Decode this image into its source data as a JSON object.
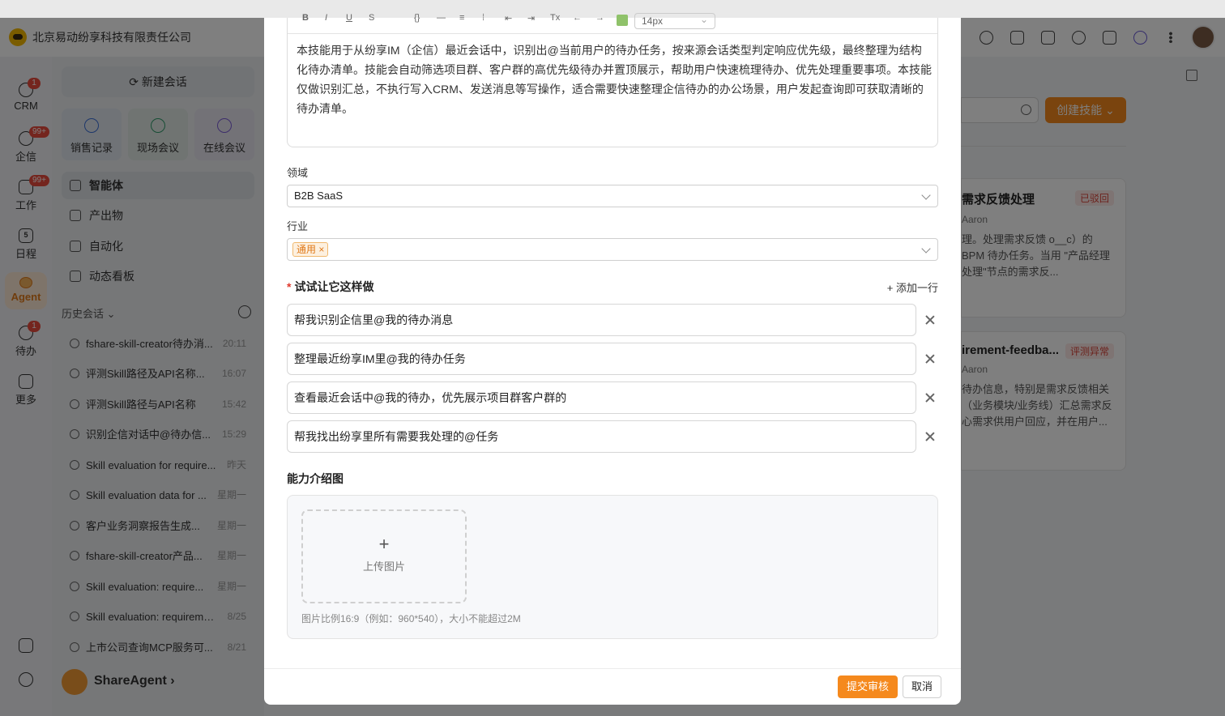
{
  "app": {
    "company": "北京易动纷享科技有限责任公司"
  },
  "leftnav": [
    {
      "label": "CRM",
      "badge": "1",
      "icon": "crm-icon"
    },
    {
      "label": "企信",
      "badge": "99+",
      "icon": "chat-icon"
    },
    {
      "label": "工作",
      "badge": "99+",
      "icon": "work-icon"
    },
    {
      "label": "日程",
      "badge": "",
      "icon": "calendar-icon",
      "glyph": "5"
    },
    {
      "label": "Agent",
      "badge": "",
      "icon": "agent-icon"
    },
    {
      "label": "待办",
      "badge": "1",
      "icon": "todo-icon"
    },
    {
      "label": "更多",
      "badge": "",
      "icon": "grid-icon"
    }
  ],
  "sidebar": {
    "new_chat": "新建会话",
    "quick": [
      "销售记录",
      "现场会议",
      "在线会议"
    ],
    "menu": [
      "智能体",
      "产出物",
      "自动化",
      "动态看板"
    ],
    "history_title": "历史会话",
    "history": [
      {
        "title": "fshare-skill-creator待办消...",
        "time": "20:11"
      },
      {
        "title": "评测Skill路径及API名称...",
        "time": "16:07"
      },
      {
        "title": "评测Skill路径与API名称",
        "time": "15:42"
      },
      {
        "title": "识别企信对话中@待办信...",
        "time": "15:29"
      },
      {
        "title": "Skill evaluation for require...",
        "time": "昨天"
      },
      {
        "title": "Skill evaluation data for ...",
        "time": "星期一"
      },
      {
        "title": "客户业务洞察报告生成...",
        "time": "星期一"
      },
      {
        "title": "fshare-skill-creator产品...",
        "time": "星期一"
      },
      {
        "title": "Skill evaluation: require...",
        "time": "星期一"
      },
      {
        "title": "Skill evaluation: requireme...",
        "time": "8/25"
      },
      {
        "title": "上市公司查询MCP服务可...",
        "time": "8/21"
      }
    ],
    "agent_name": "ShareAgent"
  },
  "right_panel": {
    "create_btn": "创建技能",
    "cards": [
      {
        "title": "需求反馈处理",
        "tag": "已驳回",
        "author": "Aaron",
        "desc": "理。处理需求反馈 o__c）的 BPM 待办任务。当用 \"产品经理处理\"节点的需求反..."
      },
      {
        "title": "irement-feedba...",
        "tag": "评测异常",
        "author": "Aaron",
        "desc": "待办信息，特别是需求反馈相关 （业务模块/业务线）汇总需求反 心需求供用户回应，并在用户..."
      }
    ]
  },
  "modal": {
    "toolbar": {
      "font_size": "14px"
    },
    "description": "本技能用于从纷享IM（企信）最近会话中，识别出@当前用户的待办任务，按来源会话类型判定响应优先级，最终整理为结构化待办清单。技能会自动筛选项目群、客户群的高优先级待办并置顶展示，帮助用户快速梳理待办、优先处理重要事项。本技能仅做识别汇总，不执行写入CRM、发送消息等写操作，适合需要快速整理企信待办的办公场景，用户发起查询即可获取清晰的待办清单。",
    "domain_label": "领域",
    "domain_value": "B2B SaaS",
    "industry_label": "行业",
    "industry_tag": "通用",
    "try_title": "试试让它这样做",
    "add_row": "+ 添加一行",
    "try_items": [
      "帮我识别企信里@我的待办消息",
      "整理最近纷享IM里@我的待办任务",
      "查看最近会话中@我的待办，优先展示项目群客户群的",
      "帮我找出纷享里所有需要我处理的@任务"
    ],
    "image_title": "能力介绍图",
    "upload_label": "上传图片",
    "upload_hint": "图片比例16:9（例如：960*540），大小不能超过2M",
    "submit": "提交审核",
    "cancel": "取消"
  }
}
